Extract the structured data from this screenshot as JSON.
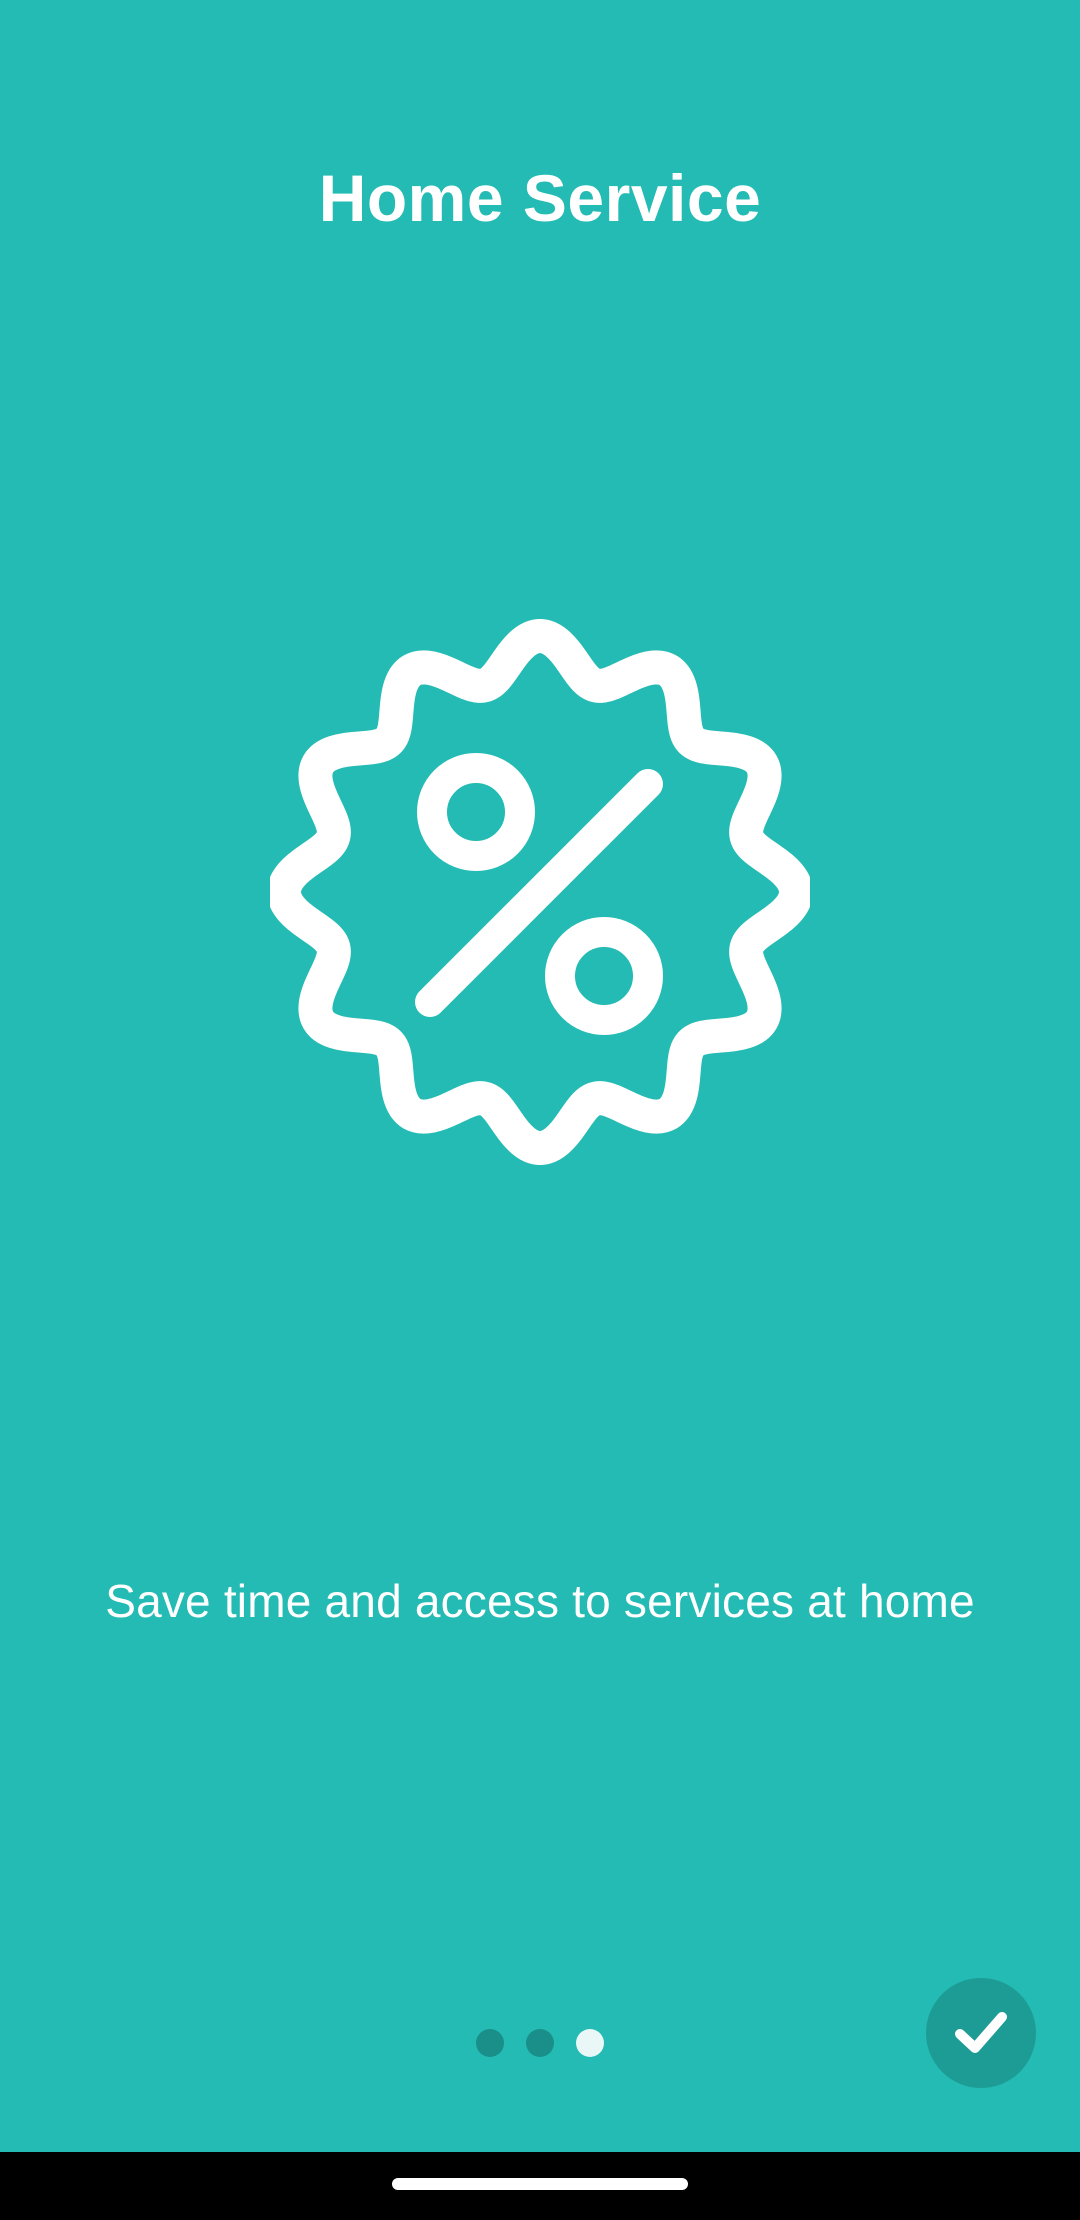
{
  "onboarding": {
    "title": "Home Service",
    "description": "Save time and access to services at home",
    "icon": "discount-badge-percent-icon",
    "page_indicator": {
      "total": 3,
      "current": 3
    },
    "done_button_icon": "checkmark-icon"
  },
  "colors": {
    "background": "#23BBB3",
    "inactive_dot": "#1A8F89",
    "active_dot": "#E9F7F6",
    "fab": "#1D9C95",
    "text": "#FFFFFF"
  }
}
